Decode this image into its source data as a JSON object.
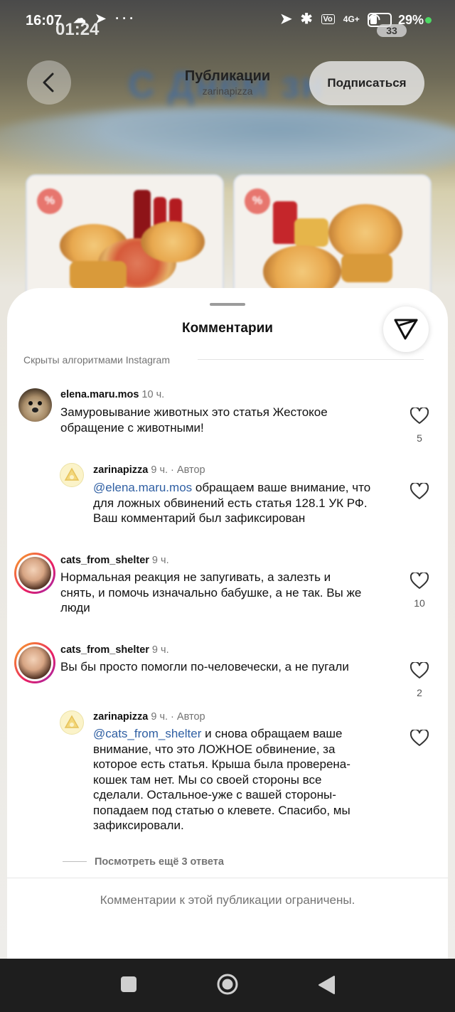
{
  "status_bar": {
    "time": "16:07",
    "overlay_time": "01:24",
    "network": "4G+",
    "battery_percent": "29",
    "pill_value": "33"
  },
  "header": {
    "title": "Публикации",
    "subtitle": "zarinapizza",
    "follow_label": "Подписаться",
    "banner_text": "С Днем зн"
  },
  "promo_cards": [
    {
      "badge": "%"
    },
    {
      "badge": "%"
    }
  ],
  "comments_sheet": {
    "title": "Комментарии",
    "hidden_label": "Скрыты алгоритмами Instagram",
    "comments": [
      {
        "username": "elena.maru.mos",
        "time": "10 ч.",
        "lines": [
          "Замуровывание животных это статья Жестокое",
          "обращение с животными!"
        ],
        "likes": "5"
      },
      {
        "username": "zarinapizza",
        "time": "9 ч.",
        "author_label": "· Автор",
        "mention": "@elena.maru.mos",
        "lines_first_rest": " обращаем ваше внимание, что",
        "lines": [
          "для ложных обвинений есть статья 128.1 УК РФ.",
          "Ваш комментарий был зафиксирован"
        ]
      },
      {
        "username": "cats_from_shelter",
        "time": "9 ч.",
        "lines": [
          "Нормальная реакция не запугивать, а залезть и",
          "снять, и помочь изначально бабушке, а не так. Вы же",
          "люди"
        ],
        "likes": "10"
      },
      {
        "username": "cats_from_shelter",
        "time": "9 ч.",
        "lines": [
          "Вы бы просто помогли по-человечески, а не пугали"
        ],
        "likes": "2"
      },
      {
        "username": "zarinapizza",
        "time": "9 ч.",
        "author_label": "· Автор",
        "mention": "@cats_from_shelter",
        "lines_first_rest": " и снова обращаем ваше",
        "lines": [
          "внимание, что это ЛОЖНОЕ обвинение, за",
          "которое есть статья. Крыша была проверена-",
          "кошек там нет. Мы со своей стороны все",
          "сделали. Остальное-уже с вашей стороны-",
          "попадаем под статью о клевете. Спасибо, мы",
          "зафиксировали."
        ]
      }
    ],
    "view_more_replies": "Посмотреть ещё 3 ответа",
    "restricted_notice": "Комментарии к этой публикации ограничены."
  },
  "colors": {
    "mention": "#2f5fa3",
    "secondary_text": "#737373",
    "story_ring_start": "#f9a825",
    "story_ring_end": "#c2185b"
  }
}
